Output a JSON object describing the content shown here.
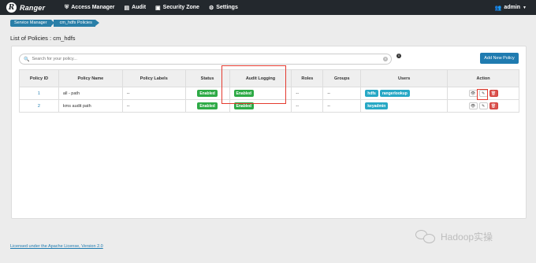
{
  "navbar": {
    "brand": "Ranger",
    "brand_icon": "ranger-logo",
    "items": [
      {
        "label": "Access Manager",
        "icon": "shield-icon"
      },
      {
        "label": "Audit",
        "icon": "file-icon"
      },
      {
        "label": "Security Zone",
        "icon": "zone-icon"
      },
      {
        "label": "Settings",
        "icon": "gear-icon"
      }
    ],
    "user": "admin"
  },
  "breadcrumb": [
    "Service Manager",
    "cm_hdfs Policies"
  ],
  "page_title": "List of Policies : cm_hdfs",
  "search": {
    "placeholder": "Search for your policy..."
  },
  "add_button": "Add New Policy",
  "table": {
    "headers": [
      "Policy ID",
      "Policy Name",
      "Policy Labels",
      "Status",
      "Audit Logging",
      "Roles",
      "Groups",
      "Users",
      "Action"
    ],
    "rows": [
      {
        "id": "1",
        "name": "all - path",
        "labels": "--",
        "status": "Enabled",
        "audit": "Enabled",
        "roles": "--",
        "groups": "--",
        "users": [
          "hdfs",
          "rangerlookup"
        ]
      },
      {
        "id": "2",
        "name": "kms audit path",
        "labels": "--",
        "status": "Enabled",
        "audit": "Enabled",
        "roles": "--",
        "groups": "--",
        "users": [
          "keyadmin"
        ]
      }
    ]
  },
  "footer": "Licensed under the Apache License, Version 2.0",
  "watermark": "Hadoop实操",
  "colors": {
    "navbar": "#23282d",
    "accent": "#1f7bb0",
    "enabled": "#2eaa46",
    "user_badge": "#27a8c5",
    "delete": "#d9534f",
    "highlight": "#e43a2f"
  }
}
